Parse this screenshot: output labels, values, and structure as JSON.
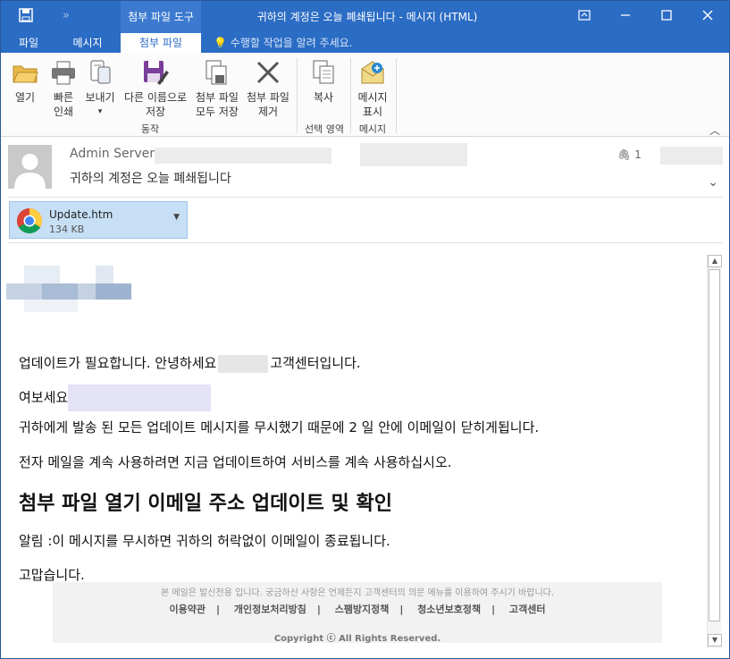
{
  "titlebar": {
    "context_tab": "첨부 파일 도구",
    "window_title": "귀하의 계정은 오늘 폐쇄됩니다 - 메시지 (HTML)"
  },
  "ribbon_tabs": [
    {
      "label": "파일"
    },
    {
      "label": "메시지"
    },
    {
      "label": "첨부 파일"
    }
  ],
  "tell_me": "수행할 작업을 알려 주세요.",
  "ribbon": {
    "buttons": [
      {
        "label1": "열기",
        "label2": ""
      },
      {
        "label1": "빠른",
        "label2": "인쇄"
      },
      {
        "label1": "보내기",
        "label2": "▾"
      },
      {
        "label1": "다른 이름으로",
        "label2": "저장"
      },
      {
        "label1": "첨부 파일",
        "label2": "모두 저장"
      },
      {
        "label1": "첨부 파일",
        "label2": "제거"
      },
      {
        "label1": "복사",
        "label2": ""
      },
      {
        "label1": "메시지",
        "label2": "표시"
      }
    ],
    "groups": [
      "동작",
      "선택 영역",
      "메시지"
    ]
  },
  "header": {
    "sender": "Admin Server",
    "subject": "귀하의 계정은 오늘 폐쇄됩니다",
    "attachment_count": "1"
  },
  "attachment": {
    "name": "Update.htm",
    "size": "134 KB"
  },
  "body": {
    "line1_a": "업데이트가 필요합니다. 안녕하세요",
    "line1_b": "고객센터입니다.",
    "line2": "여보세요",
    "line3": "귀하에게 발송 된 모든 업데이트 메시지를 무시했기 때문에 2 일 안에 이메일이 닫히게됩니다.",
    "line4": "전자 메일을 계속 사용하려면 지금 업데이트하여 서비스를 계속 사용하십시오.",
    "heading": "첨부 파일 열기 이메일 주소 업데이트 및 확인",
    "line5": "알림 :이 메시지를 무시하면 귀하의 허락없이 이메일이 종료됩니다.",
    "line6": "고맙습니다."
  },
  "footer": {
    "note": "본 메일은 발신전용 입니다. 궁금하신 사항은 언제든지 고객센터의 의문 메뉴를 이용하여 주시기 바랍니다.",
    "links": [
      "이용약관",
      "개인정보처리방침",
      "스팸방지정책",
      "청소년보호정책",
      "고객센터"
    ],
    "copyright": "Copyright ⓒ All Rights Reserved."
  },
  "colors": {
    "accent": "#2b6cc4",
    "attachment_bg": "#c6dff5"
  }
}
